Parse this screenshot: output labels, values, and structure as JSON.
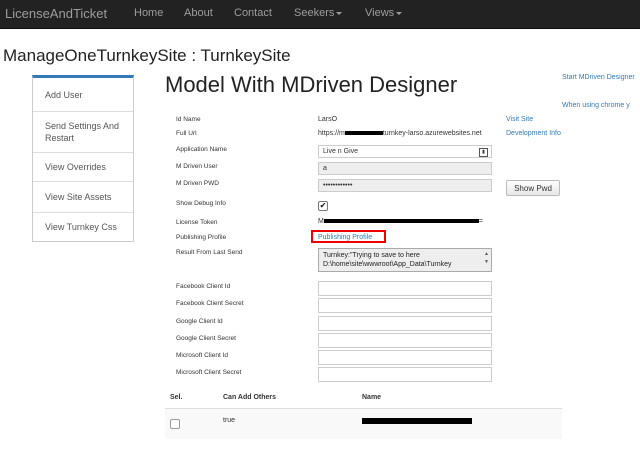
{
  "navbar": {
    "brand": "LicenseAndTicket",
    "items": [
      "Home",
      "About",
      "Contact",
      "Seekers",
      "Views"
    ]
  },
  "site_title": "ManageOneTurnkeySite : TurnkeySite",
  "sidebar": {
    "items": [
      "Add User",
      "Send Settings And Restart",
      "View Overrides",
      "View Site Assets",
      "View Turnkey Css"
    ]
  },
  "heading": "Model With MDriven Designer",
  "right_links": {
    "start": "Start MDriven Designer",
    "chrome": "When using chrome y"
  },
  "form": {
    "id_name": {
      "label": "Id Name",
      "value": "LarsO"
    },
    "full_url": {
      "label": "Full Url",
      "value_prefix": "https://m",
      "value_suffix": "turnkey-larso.azurewebsites.net"
    },
    "app_name": {
      "label": "Application Name",
      "value": "Live n Give"
    },
    "mdriven_user": {
      "label": "M Driven User",
      "value": "a"
    },
    "mdriven_pwd": {
      "label": "M Driven PWD",
      "value": "••••••••••••"
    },
    "show_debug": {
      "label": "Show Debug Info",
      "checked": true
    },
    "license_token": {
      "label": "License Token",
      "value_prefix": "M",
      "value_suffix": "="
    },
    "publishing_profile": {
      "label": "Publishing Profile",
      "link": "Publishing Profile"
    },
    "result_from_last_send": {
      "label": "Result From Last Send",
      "line1": "Turnkey:\"Trying to save to here",
      "line2": "D:\\home\\site\\wwwroot\\App_Data\\Turnkey"
    },
    "facebook_client_id": {
      "label": "Facebook Client Id",
      "value": ""
    },
    "facebook_client_secret": {
      "label": "Facebook Client Secret",
      "value": ""
    },
    "google_client_id": {
      "label": "Google Client Id",
      "value": ""
    },
    "google_client_secret": {
      "label": "Google Client Secret",
      "value": ""
    },
    "microsoft_client_id": {
      "label": "Microsoft Client Id",
      "value": ""
    },
    "microsoft_client_secret": {
      "label": "Microsoft Client Secret",
      "value": ""
    }
  },
  "side_links": {
    "visit_site": "Visit Site",
    "development_info": "Development Info",
    "show_pwd": "Show Pwd"
  },
  "table": {
    "headers": [
      "Sel.",
      "Can Add Others",
      "Name"
    ],
    "rows": [
      {
        "can_add_others": "true"
      }
    ]
  }
}
